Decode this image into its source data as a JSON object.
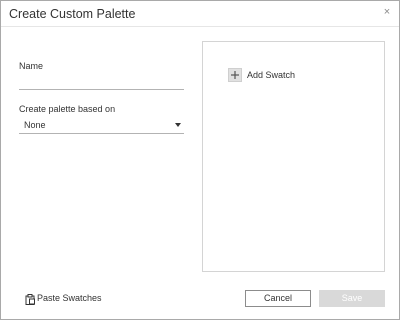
{
  "dialog": {
    "title": "Create Custom Palette",
    "close_glyph": "×"
  },
  "form": {
    "name_label": "Name",
    "name_value": "",
    "based_on_label": "Create palette based on",
    "based_on_value": "None"
  },
  "swatches": {
    "add_label": "Add Swatch"
  },
  "footer": {
    "paste_label": "Paste Swatches",
    "cancel_label": "Cancel",
    "save_label": "Save"
  },
  "icons": {
    "close": "close-icon",
    "plus": "plus-icon",
    "paste": "clipboard-icon",
    "dropdown": "caret-down-icon"
  }
}
